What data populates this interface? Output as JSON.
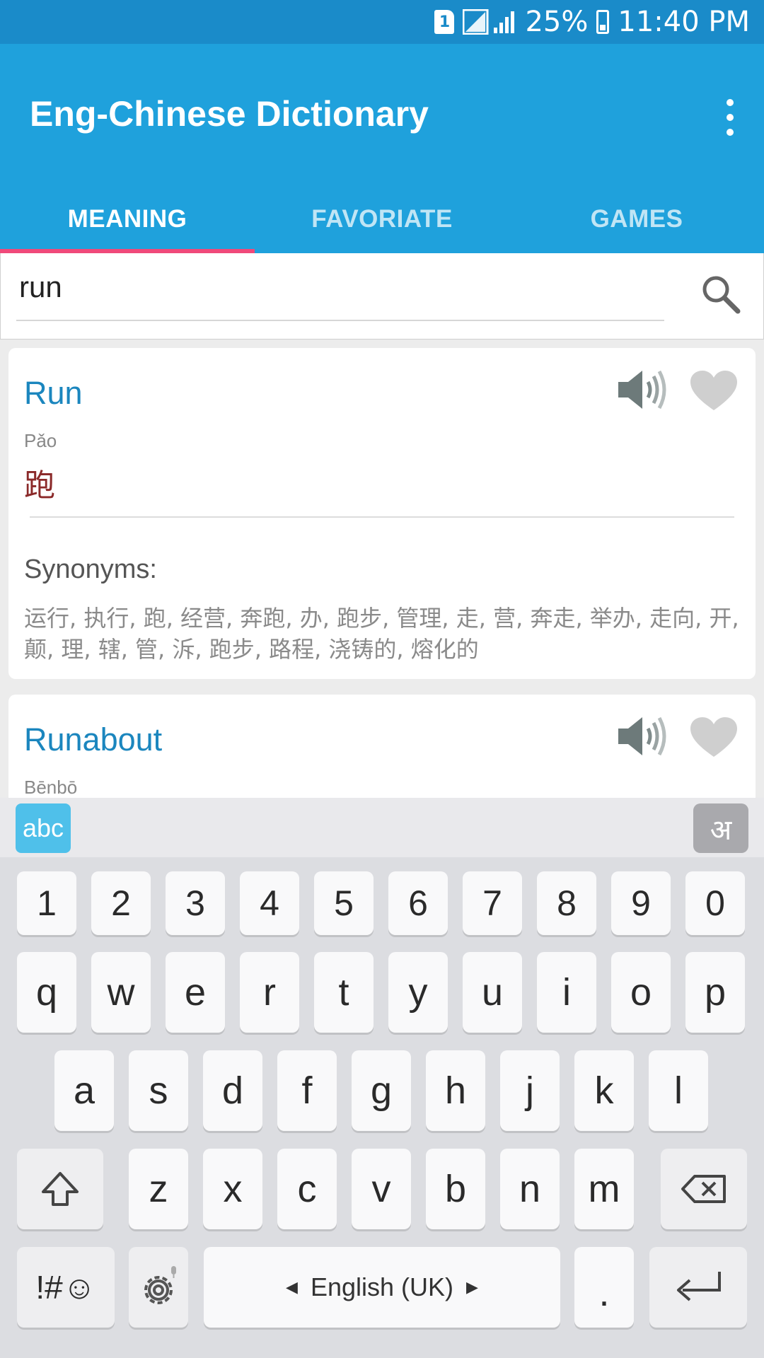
{
  "status_bar": {
    "sim": "1",
    "battery": "25%",
    "time": "11:40 PM"
  },
  "app": {
    "title": "Eng-Chinese Dictionary"
  },
  "tabs": [
    {
      "label": "MEANING"
    },
    {
      "label": "FAVORIATE"
    },
    {
      "label": "GAMES"
    }
  ],
  "search": {
    "value": "run",
    "placeholder": ""
  },
  "results": [
    {
      "word": "Run",
      "pinyin": "Pǎo",
      "chinese": "跑",
      "synonyms_label": "Synonyms:",
      "synonyms": "运行, 执行, 跑, 经营, 奔跑, 办, 跑步, 管理, 走, 营, 奔走, 举办, 走向, 开, 颠, 理, 辖, 管, 泝, 跑步, 路程, 浇铸的, 熔化的"
    },
    {
      "word": "Runabout",
      "pinyin": "Bēnbō"
    }
  ],
  "keyboard": {
    "abc_label": "abc",
    "hindi_label": "अ",
    "numbers": [
      "1",
      "2",
      "3",
      "4",
      "5",
      "6",
      "7",
      "8",
      "9",
      "0"
    ],
    "row1": [
      "q",
      "w",
      "e",
      "r",
      "t",
      "y",
      "u",
      "i",
      "o",
      "p"
    ],
    "row2": [
      "a",
      "s",
      "d",
      "f",
      "g",
      "h",
      "j",
      "k",
      "l"
    ],
    "row3": [
      "z",
      "x",
      "c",
      "v",
      "b",
      "n",
      "m"
    ],
    "symbols_label": "!#☺",
    "space_label": "English (UK)",
    "period": "."
  },
  "colors": {
    "status_bar": "#1a8bc9",
    "app_bar": "#1fa1dc",
    "tab_indicator": "#f0497a",
    "word": "#1b86be",
    "chinese": "#8b2a2a"
  },
  "icons": [
    "sim-icon",
    "signal-icon",
    "battery-icon",
    "more-vert-icon",
    "search-icon",
    "speaker-icon",
    "heart-icon",
    "shift-icon",
    "backspace-icon",
    "settings-icon",
    "mic-icon",
    "enter-icon"
  ]
}
